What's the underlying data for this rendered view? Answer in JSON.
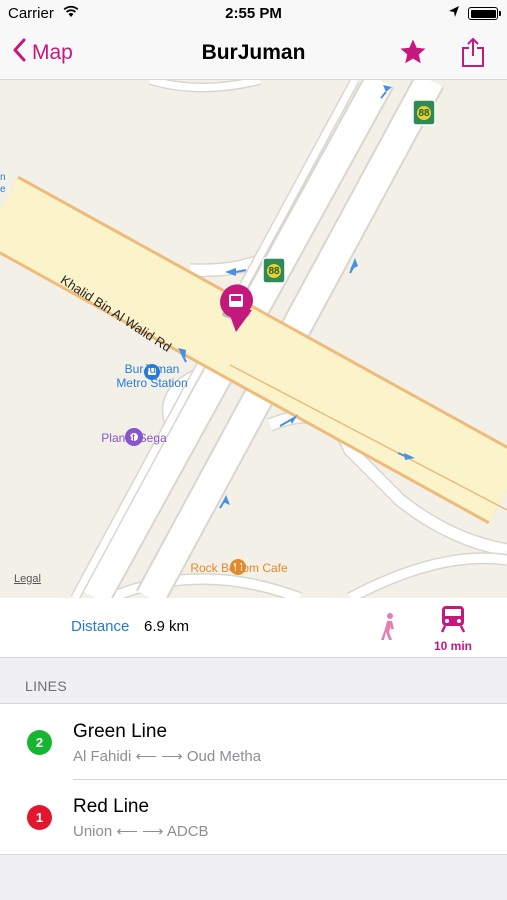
{
  "status_bar": {
    "carrier": "Carrier",
    "time": "2:55 PM"
  },
  "nav": {
    "back_label": "Map",
    "title": "BurJuman",
    "accent_color": "#c5187c"
  },
  "map": {
    "road_label": "Khalid Bin Al Walid Rd",
    "edge_label_line1": "n",
    "edge_label_line2": "e",
    "poi_metro_line1": "BurJuman",
    "poi_metro_line2": "Metro Station",
    "poi_sega": "Planet Sega",
    "poi_cafe": "Rock Bottom Cafe",
    "road_sign": "88",
    "legal": "Legal"
  },
  "distance": {
    "label": "Distance",
    "value": "6.9 km",
    "train_time": "10 min"
  },
  "lines_section": {
    "header": "LINES",
    "items": [
      {
        "number": "2",
        "name": "Green Line",
        "route": "Al Fahidi ⟵ ⟶ Oud Metha",
        "color": "#18b531"
      },
      {
        "number": "1",
        "name": "Red Line",
        "route": "Union ⟵ ⟶ ADCB",
        "color": "#e2162f"
      }
    ]
  }
}
